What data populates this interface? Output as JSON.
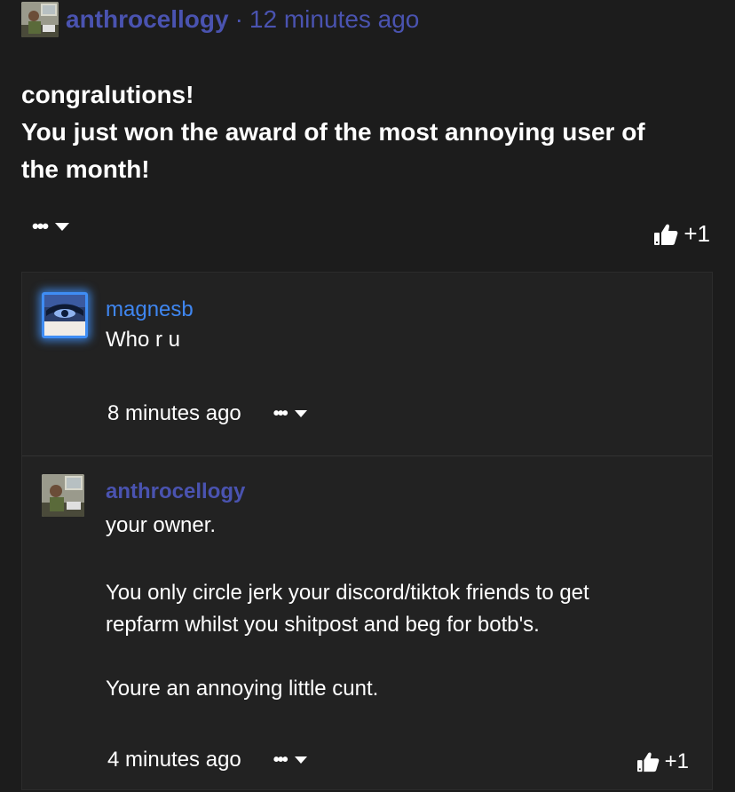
{
  "post": {
    "username": "anthrocellogy",
    "separator": "·",
    "time": "12 minutes ago",
    "lines": [
      "congralutions!",
      "You just won the award of the most annoying user of",
      "the month!"
    ],
    "menu_label": "•••",
    "like_count": "+1"
  },
  "replies": [
    {
      "username": "magnesb",
      "text": "Who r u",
      "time": "8 minutes ago",
      "menu_label": "•••"
    },
    {
      "username": "anthrocellogy",
      "lines": [
        "your owner.",
        "You only circle jerk your discord/tiktok friends to get",
        "repfarm whilst you shitpost and beg for botb's.",
        "Youre an annoying little cunt."
      ],
      "time": "4 minutes ago",
      "menu_label": "•••",
      "like_count": "+1"
    }
  ],
  "icons": {
    "like": "thumbs-up-icon",
    "menu": "ellipsis-icon",
    "caret": "caret-down-icon"
  },
  "colors": {
    "background": "#1c1c1c",
    "reply_background": "#222222",
    "username": "#4a53b0",
    "reply_username_glow": "#3f86f0",
    "text": "#ffffff"
  }
}
